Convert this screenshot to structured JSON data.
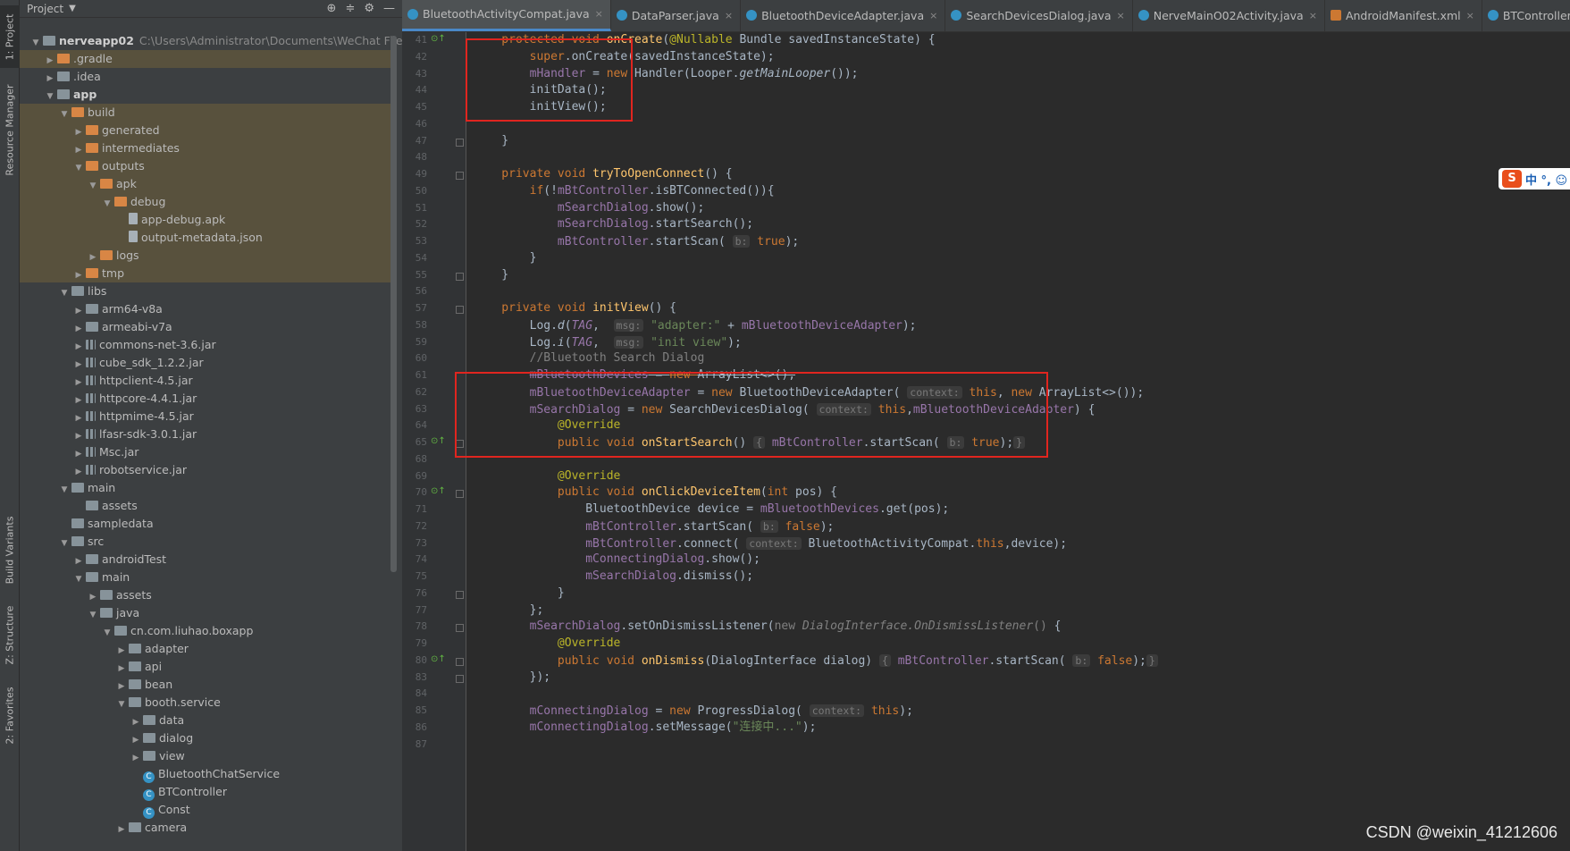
{
  "left_strip": {
    "project_tab": "1: Project",
    "resource_manager_tab": "Resource Manager",
    "build_variants_tab": "Build Variants",
    "structure_tab": "Z: Structure",
    "favorites_tab": "2: Favorites"
  },
  "project_panel": {
    "title": "Project",
    "tree": [
      {
        "depth": 0,
        "arrow": "▼",
        "icon": "folder-blue",
        "label": "nerveapp02",
        "bold": true,
        "path": "C:\\Users\\Administrator\\Documents\\WeChat Files\\wxid"
      },
      {
        "depth": 1,
        "arrow": "▶",
        "icon": "folder-orange",
        "label": ".gradle",
        "hl": true
      },
      {
        "depth": 1,
        "arrow": "▶",
        "icon": "folder-blue",
        "label": ".idea"
      },
      {
        "depth": 1,
        "arrow": "▼",
        "icon": "folder-blue",
        "label": "app",
        "bold": true
      },
      {
        "depth": 2,
        "arrow": "▼",
        "icon": "folder-orange",
        "label": "build",
        "hl": true
      },
      {
        "depth": 3,
        "arrow": "▶",
        "icon": "folder-orange",
        "label": "generated",
        "hl": true
      },
      {
        "depth": 3,
        "arrow": "▶",
        "icon": "folder-orange",
        "label": "intermediates",
        "hl": true
      },
      {
        "depth": 3,
        "arrow": "▼",
        "icon": "folder-orange",
        "label": "outputs",
        "hl": true
      },
      {
        "depth": 4,
        "arrow": "▼",
        "icon": "folder-orange",
        "label": "apk",
        "hl": true
      },
      {
        "depth": 5,
        "arrow": "▼",
        "icon": "folder-orange",
        "label": "debug",
        "hl": true
      },
      {
        "depth": 6,
        "arrow": "",
        "icon": "file",
        "label": "app-debug.apk",
        "hl": true
      },
      {
        "depth": 6,
        "arrow": "",
        "icon": "file",
        "label": "output-metadata.json",
        "hl": true
      },
      {
        "depth": 4,
        "arrow": "▶",
        "icon": "folder-orange",
        "label": "logs",
        "hl": true
      },
      {
        "depth": 3,
        "arrow": "▶",
        "icon": "folder-orange",
        "label": "tmp",
        "hl": true
      },
      {
        "depth": 2,
        "arrow": "▼",
        "icon": "folder-blue",
        "label": "libs"
      },
      {
        "depth": 3,
        "arrow": "▶",
        "icon": "folder-blue",
        "label": "arm64-v8a"
      },
      {
        "depth": 3,
        "arrow": "▶",
        "icon": "folder-blue",
        "label": "armeabi-v7a"
      },
      {
        "depth": 3,
        "arrow": "▶",
        "icon": "jar",
        "label": "commons-net-3.6.jar"
      },
      {
        "depth": 3,
        "arrow": "▶",
        "icon": "jar",
        "label": "cube_sdk_1.2.2.jar"
      },
      {
        "depth": 3,
        "arrow": "▶",
        "icon": "jar",
        "label": "httpclient-4.5.jar"
      },
      {
        "depth": 3,
        "arrow": "▶",
        "icon": "jar",
        "label": "httpcore-4.4.1.jar"
      },
      {
        "depth": 3,
        "arrow": "▶",
        "icon": "jar",
        "label": "httpmime-4.5.jar"
      },
      {
        "depth": 3,
        "arrow": "▶",
        "icon": "jar",
        "label": "lfasr-sdk-3.0.1.jar"
      },
      {
        "depth": 3,
        "arrow": "▶",
        "icon": "jar",
        "label": "Msc.jar"
      },
      {
        "depth": 3,
        "arrow": "▶",
        "icon": "jar",
        "label": "robotservice.jar"
      },
      {
        "depth": 2,
        "arrow": "▼",
        "icon": "folder-blue",
        "label": "main"
      },
      {
        "depth": 3,
        "arrow": "",
        "icon": "folder-blue",
        "label": "assets"
      },
      {
        "depth": 2,
        "arrow": "",
        "icon": "folder-blue",
        "label": "sampledata"
      },
      {
        "depth": 2,
        "arrow": "▼",
        "icon": "folder-blue",
        "label": "src"
      },
      {
        "depth": 3,
        "arrow": "▶",
        "icon": "folder-blue",
        "label": "androidTest"
      },
      {
        "depth": 3,
        "arrow": "▼",
        "icon": "folder-blue",
        "label": "main"
      },
      {
        "depth": 4,
        "arrow": "▶",
        "icon": "folder-blue",
        "label": "assets"
      },
      {
        "depth": 4,
        "arrow": "▼",
        "icon": "folder-blue",
        "label": "java"
      },
      {
        "depth": 5,
        "arrow": "▼",
        "icon": "folder-blue",
        "label": "cn.com.liuhao.boxapp"
      },
      {
        "depth": 6,
        "arrow": "▶",
        "icon": "folder-blue",
        "label": "adapter"
      },
      {
        "depth": 6,
        "arrow": "▶",
        "icon": "folder-blue",
        "label": "api"
      },
      {
        "depth": 6,
        "arrow": "▶",
        "icon": "folder-blue",
        "label": "bean"
      },
      {
        "depth": 6,
        "arrow": "▼",
        "icon": "folder-blue",
        "label": "booth.service"
      },
      {
        "depth": 7,
        "arrow": "▶",
        "icon": "folder-blue",
        "label": "data"
      },
      {
        "depth": 7,
        "arrow": "▶",
        "icon": "folder-blue",
        "label": "dialog"
      },
      {
        "depth": 7,
        "arrow": "▶",
        "icon": "folder-blue",
        "label": "view"
      },
      {
        "depth": 7,
        "arrow": "",
        "icon": "cls",
        "label": "BluetoothChatService"
      },
      {
        "depth": 7,
        "arrow": "",
        "icon": "cls",
        "label": "BTController"
      },
      {
        "depth": 7,
        "arrow": "",
        "icon": "cls",
        "label": "Const"
      },
      {
        "depth": 6,
        "arrow": "▶",
        "icon": "folder-blue",
        "label": "camera"
      }
    ]
  },
  "tabs": [
    {
      "label": "BluetoothActivityCompat.java",
      "active": true,
      "kind": "class"
    },
    {
      "label": "DataParser.java",
      "kind": "class"
    },
    {
      "label": "BluetoothDeviceAdapter.java",
      "kind": "class"
    },
    {
      "label": "SearchDevicesDialog.java",
      "kind": "class"
    },
    {
      "label": "NerveMainO02Activity.java",
      "kind": "class"
    },
    {
      "label": "AndroidManifest.xml",
      "kind": "xml"
    },
    {
      "label": "BTController.java",
      "kind": "class"
    }
  ],
  "code_lines": [
    {
      "n": "41",
      "marker": "⊙↑",
      "segs": [
        [
          "kw",
          "    protected void "
        ],
        [
          "fn",
          "onCreate"
        ],
        [
          "",
          "("
        ],
        [
          "ann",
          "@Nullable"
        ],
        [
          "",
          " Bundle savedInstanceState) {"
        ]
      ]
    },
    {
      "n": "42",
      "segs": [
        [
          "",
          "        "
        ],
        [
          "kw",
          "super"
        ],
        [
          "",
          ".onCreate(savedInstanceState);"
        ]
      ]
    },
    {
      "n": "43",
      "segs": [
        [
          "",
          "        "
        ],
        [
          "fld",
          "mHandler"
        ],
        [
          "",
          " = "
        ],
        [
          "kw",
          "new "
        ],
        [
          "",
          "Handler(Looper."
        ],
        [
          "it",
          "getMainLooper"
        ],
        [
          "",
          "());"
        ]
      ]
    },
    {
      "n": "44",
      "segs": [
        [
          "",
          "        initData();"
        ]
      ]
    },
    {
      "n": "45",
      "segs": [
        [
          "",
          "        initView();"
        ]
      ]
    },
    {
      "n": "46",
      "segs": []
    },
    {
      "n": "47",
      "segs": [
        [
          "",
          "    }"
        ]
      ]
    },
    {
      "n": "48",
      "segs": []
    },
    {
      "n": "49",
      "segs": [
        [
          "kw",
          "    private void "
        ],
        [
          "fn",
          "tryToOpenConnect"
        ],
        [
          "",
          "() {"
        ]
      ]
    },
    {
      "n": "50",
      "segs": [
        [
          "",
          "        "
        ],
        [
          "kw",
          "if"
        ],
        [
          "",
          "(!"
        ],
        [
          "fld",
          "mBtController"
        ],
        [
          "",
          ".isBTConnected()){"
        ]
      ]
    },
    {
      "n": "51",
      "segs": [
        [
          "",
          "            "
        ],
        [
          "fld",
          "mSearchDialog"
        ],
        [
          "",
          ".show();"
        ]
      ]
    },
    {
      "n": "52",
      "segs": [
        [
          "",
          "            "
        ],
        [
          "fld",
          "mSearchDialog"
        ],
        [
          "",
          ".startSearch();"
        ]
      ]
    },
    {
      "n": "53",
      "segs": [
        [
          "",
          "            "
        ],
        [
          "fld",
          "mBtController"
        ],
        [
          "",
          ".startScan( "
        ],
        [
          "hint",
          "b:"
        ],
        [
          "",
          " "
        ],
        [
          "kw",
          "true"
        ],
        [
          "",
          ");"
        ]
      ]
    },
    {
      "n": "54",
      "segs": [
        [
          "",
          "        }"
        ]
      ]
    },
    {
      "n": "55",
      "segs": [
        [
          "",
          "    }"
        ]
      ]
    },
    {
      "n": "56",
      "segs": []
    },
    {
      "n": "57",
      "segs": [
        [
          "kw",
          "    private void "
        ],
        [
          "fn",
          "initView"
        ],
        [
          "",
          "() {"
        ]
      ]
    },
    {
      "n": "58",
      "segs": [
        [
          "",
          "        Log."
        ],
        [
          "it",
          "d"
        ],
        [
          "",
          "("
        ],
        [
          "fld it",
          "TAG"
        ],
        [
          "",
          ",  "
        ],
        [
          "hint",
          "msg:"
        ],
        [
          "",
          " "
        ],
        [
          "str",
          "\"adapter:\""
        ],
        [
          "",
          " + "
        ],
        [
          "fld",
          "mBluetoothDeviceAdapter"
        ],
        [
          "",
          ");"
        ]
      ]
    },
    {
      "n": "59",
      "segs": [
        [
          "",
          "        Log."
        ],
        [
          "it",
          "i"
        ],
        [
          "",
          "("
        ],
        [
          "fld it",
          "TAG"
        ],
        [
          "",
          ",  "
        ],
        [
          "hint",
          "msg:"
        ],
        [
          "",
          " "
        ],
        [
          "str",
          "\"init view\""
        ],
        [
          "",
          ");"
        ]
      ]
    },
    {
      "n": "60",
      "segs": [
        [
          "cmt",
          "        //Bluetooth Search Dialog"
        ]
      ]
    },
    {
      "n": "61",
      "segs": [
        [
          "",
          "        "
        ],
        [
          "fld strike",
          "mBluetoothDevices"
        ],
        [
          "strike",
          " = "
        ],
        [
          "kw strike",
          "new "
        ],
        [
          "strike",
          "ArrayList<>();"
        ]
      ]
    },
    {
      "n": "62",
      "segs": [
        [
          "",
          "        "
        ],
        [
          "fld",
          "mBluetoothDeviceAdapter"
        ],
        [
          "",
          " = "
        ],
        [
          "kw",
          "new "
        ],
        [
          "",
          "BluetoothDeviceAdapter( "
        ],
        [
          "hint",
          "context:"
        ],
        [
          "",
          " "
        ],
        [
          "kw",
          "this"
        ],
        [
          "",
          ", "
        ],
        [
          "kw",
          "new "
        ],
        [
          "",
          "ArrayList<>());"
        ]
      ]
    },
    {
      "n": "63",
      "segs": [
        [
          "",
          "        "
        ],
        [
          "fld",
          "mSearchDialog"
        ],
        [
          "",
          " = "
        ],
        [
          "kw",
          "new "
        ],
        [
          "",
          "SearchDevicesDialog( "
        ],
        [
          "hint",
          "context:"
        ],
        [
          "",
          " "
        ],
        [
          "kw",
          "this"
        ],
        [
          "",
          ","
        ],
        [
          "fld",
          "mBluetoothDeviceAdapter"
        ],
        [
          "",
          ") {"
        ]
      ]
    },
    {
      "n": "64",
      "segs": [
        [
          "",
          "            "
        ],
        [
          "ann",
          "@Override"
        ]
      ]
    },
    {
      "n": "65",
      "marker": "⊙↑",
      "segs": [
        [
          "kw",
          "            public void "
        ],
        [
          "fn",
          "onStartSearch"
        ],
        [
          "",
          "() "
        ],
        [
          "hint",
          "{"
        ],
        [
          "",
          " "
        ],
        [
          "fld",
          "mBtController"
        ],
        [
          "",
          ".startScan( "
        ],
        [
          "hint",
          "b:"
        ],
        [
          "",
          " "
        ],
        [
          "kw",
          "true"
        ],
        [
          "",
          ");"
        ],
        [
          "hint",
          "}"
        ]
      ]
    },
    {
      "n": "68",
      "segs": []
    },
    {
      "n": "69",
      "segs": [
        [
          "",
          "            "
        ],
        [
          "ann",
          "@Override"
        ]
      ]
    },
    {
      "n": "70",
      "marker": "⊙↑",
      "segs": [
        [
          "kw",
          "            public void "
        ],
        [
          "fn",
          "onClickDeviceItem"
        ],
        [
          "",
          "("
        ],
        [
          "kw",
          "int"
        ],
        [
          "",
          " pos) {"
        ]
      ]
    },
    {
      "n": "71",
      "segs": [
        [
          "",
          "                BluetoothDevice device = "
        ],
        [
          "fld",
          "mBluetoothDevices"
        ],
        [
          "",
          ".get(pos);"
        ]
      ]
    },
    {
      "n": "72",
      "segs": [
        [
          "",
          "                "
        ],
        [
          "fld",
          "mBtController"
        ],
        [
          "",
          ".startScan( "
        ],
        [
          "hint",
          "b:"
        ],
        [
          "",
          " "
        ],
        [
          "kw",
          "false"
        ],
        [
          "",
          ");"
        ]
      ]
    },
    {
      "n": "73",
      "segs": [
        [
          "",
          "                "
        ],
        [
          "fld",
          "mBtController"
        ],
        [
          "",
          ".connect( "
        ],
        [
          "hint",
          "context:"
        ],
        [
          "",
          " BluetoothActivityCompat."
        ],
        [
          "kw",
          "this"
        ],
        [
          "",
          ",device);"
        ]
      ]
    },
    {
      "n": "74",
      "segs": [
        [
          "",
          "                "
        ],
        [
          "fld",
          "mConnectingDialog"
        ],
        [
          "",
          ".show();"
        ]
      ]
    },
    {
      "n": "75",
      "segs": [
        [
          "",
          "                "
        ],
        [
          "fld",
          "mSearchDialog"
        ],
        [
          "",
          ".dismiss();"
        ]
      ]
    },
    {
      "n": "76",
      "segs": [
        [
          "",
          "            }"
        ]
      ]
    },
    {
      "n": "77",
      "segs": [
        [
          "",
          "        };"
        ]
      ]
    },
    {
      "n": "78",
      "segs": [
        [
          "",
          "        "
        ],
        [
          "fld",
          "mSearchDialog"
        ],
        [
          "",
          ".setOnDismissListener("
        ],
        [
          "cmt",
          "new "
        ],
        [
          "cmt it",
          "DialogInterface.OnDismissListener"
        ],
        [
          "cmt",
          "() "
        ],
        [
          "",
          "{"
        ]
      ]
    },
    {
      "n": "79",
      "segs": [
        [
          "",
          "            "
        ],
        [
          "ann",
          "@Override"
        ]
      ]
    },
    {
      "n": "80",
      "marker": "⊙↑",
      "segs": [
        [
          "kw",
          "            public void "
        ],
        [
          "fn",
          "onDismiss"
        ],
        [
          "",
          "(DialogInterface dialog) "
        ],
        [
          "hint",
          "{"
        ],
        [
          "",
          " "
        ],
        [
          "fld",
          "mBtController"
        ],
        [
          "",
          ".startScan( "
        ],
        [
          "hint",
          "b:"
        ],
        [
          "",
          " "
        ],
        [
          "kw",
          "false"
        ],
        [
          "",
          ");"
        ],
        [
          "hint",
          "}"
        ]
      ]
    },
    {
      "n": "83",
      "segs": [
        [
          "",
          "        });"
        ]
      ]
    },
    {
      "n": "84",
      "segs": []
    },
    {
      "n": "85",
      "segs": [
        [
          "",
          "        "
        ],
        [
          "fld",
          "mConnectingDialog"
        ],
        [
          "",
          " = "
        ],
        [
          "kw",
          "new "
        ],
        [
          "",
          "ProgressDialog( "
        ],
        [
          "hint",
          "context:"
        ],
        [
          "",
          " "
        ],
        [
          "kw",
          "this"
        ],
        [
          "",
          ");"
        ]
      ]
    },
    {
      "n": "86",
      "segs": [
        [
          "",
          "        "
        ],
        [
          "fld",
          "mConnectingDialog"
        ],
        [
          "",
          ".setMessage("
        ],
        [
          "str",
          "\"连接中...\""
        ],
        [
          "",
          ");"
        ]
      ]
    },
    {
      "n": "87",
      "segs": []
    }
  ],
  "ime": {
    "logo": "S",
    "text": "中 °, ☺"
  },
  "watermark": "CSDN @weixin_41212606"
}
